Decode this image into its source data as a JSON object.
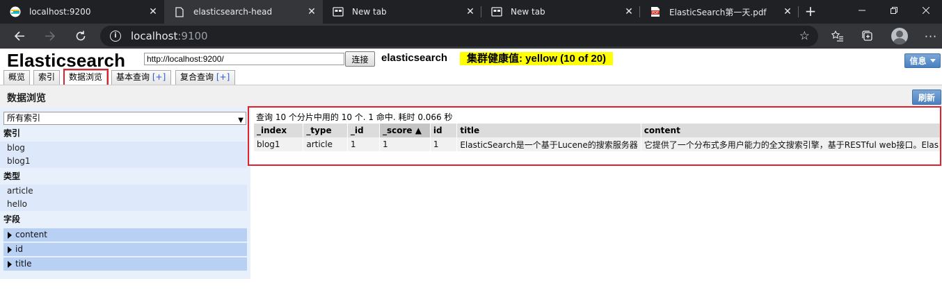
{
  "browser": {
    "tabs": [
      {
        "title": "localhost:9200",
        "icon": "elasticsearch-favicon"
      },
      {
        "title": "elasticsearch-head",
        "icon": "page-icon"
      },
      {
        "title": "New tab",
        "icon": "new-tab-icon"
      },
      {
        "title": "New tab",
        "icon": "new-tab-icon"
      },
      {
        "title": "ElasticSearch第一天.pdf",
        "icon": "pdf-icon"
      }
    ],
    "address": {
      "host": "localhost",
      "port": ":9100"
    }
  },
  "header": {
    "logo": "Elasticsearch",
    "url_value": "http://localhost:9200/",
    "connect_label": "连接",
    "cluster_name": "elasticsearch",
    "health": "集群健康值: yellow (10 of 20)",
    "health_color": "#ffff00",
    "info_label": "信息"
  },
  "nav": {
    "tabs": [
      {
        "label": "概览"
      },
      {
        "label": "索引"
      },
      {
        "label": "数据浏览"
      },
      {
        "label": "基本查询",
        "plus": "[+]"
      },
      {
        "label": "复合查询",
        "plus": "[+]"
      }
    ]
  },
  "browse": {
    "title": "数据浏览",
    "refresh_label": "刷新",
    "index_select": "所有索引",
    "sections": {
      "indices": "索引",
      "types": "类型",
      "fields": "字段"
    },
    "indices": [
      "blog",
      "blog1"
    ],
    "types": [
      "article",
      "hello"
    ],
    "fields": [
      "content",
      "id",
      "title"
    ]
  },
  "results": {
    "summary": "查询 10 个分片中用的 10 个. 1 命中. 耗时 0.066 秒",
    "columns": [
      "_index",
      "_type",
      "_id",
      "_score ▲",
      "id",
      "title",
      "content"
    ],
    "rows": [
      [
        "blog1",
        "article",
        "1",
        "1",
        "1",
        "ElasticSearch是一个基于Lucene的搜索服务器",
        "它提供了一个分布式多用户能力的全文搜索引擎，基于RESTful web接口。Elas"
      ]
    ]
  }
}
